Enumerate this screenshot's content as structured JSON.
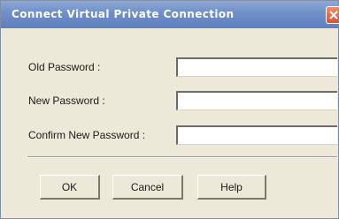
{
  "dialog": {
    "title": "Connect Virtual Private Connection",
    "close_icon": "close-icon",
    "close_color": "#d9532f"
  },
  "fields": {
    "old_password": {
      "label": "Old Password :",
      "value": ""
    },
    "new_password": {
      "label": "New Password :",
      "value": ""
    },
    "confirm_password": {
      "label": "Confirm New Password :",
      "value": ""
    }
  },
  "buttons": {
    "ok_label": "OK",
    "cancel_label": "Cancel",
    "help_label": "Help"
  },
  "colors": {
    "title_bar": "#6f8ec8",
    "window_bg": "#ece9d8"
  }
}
